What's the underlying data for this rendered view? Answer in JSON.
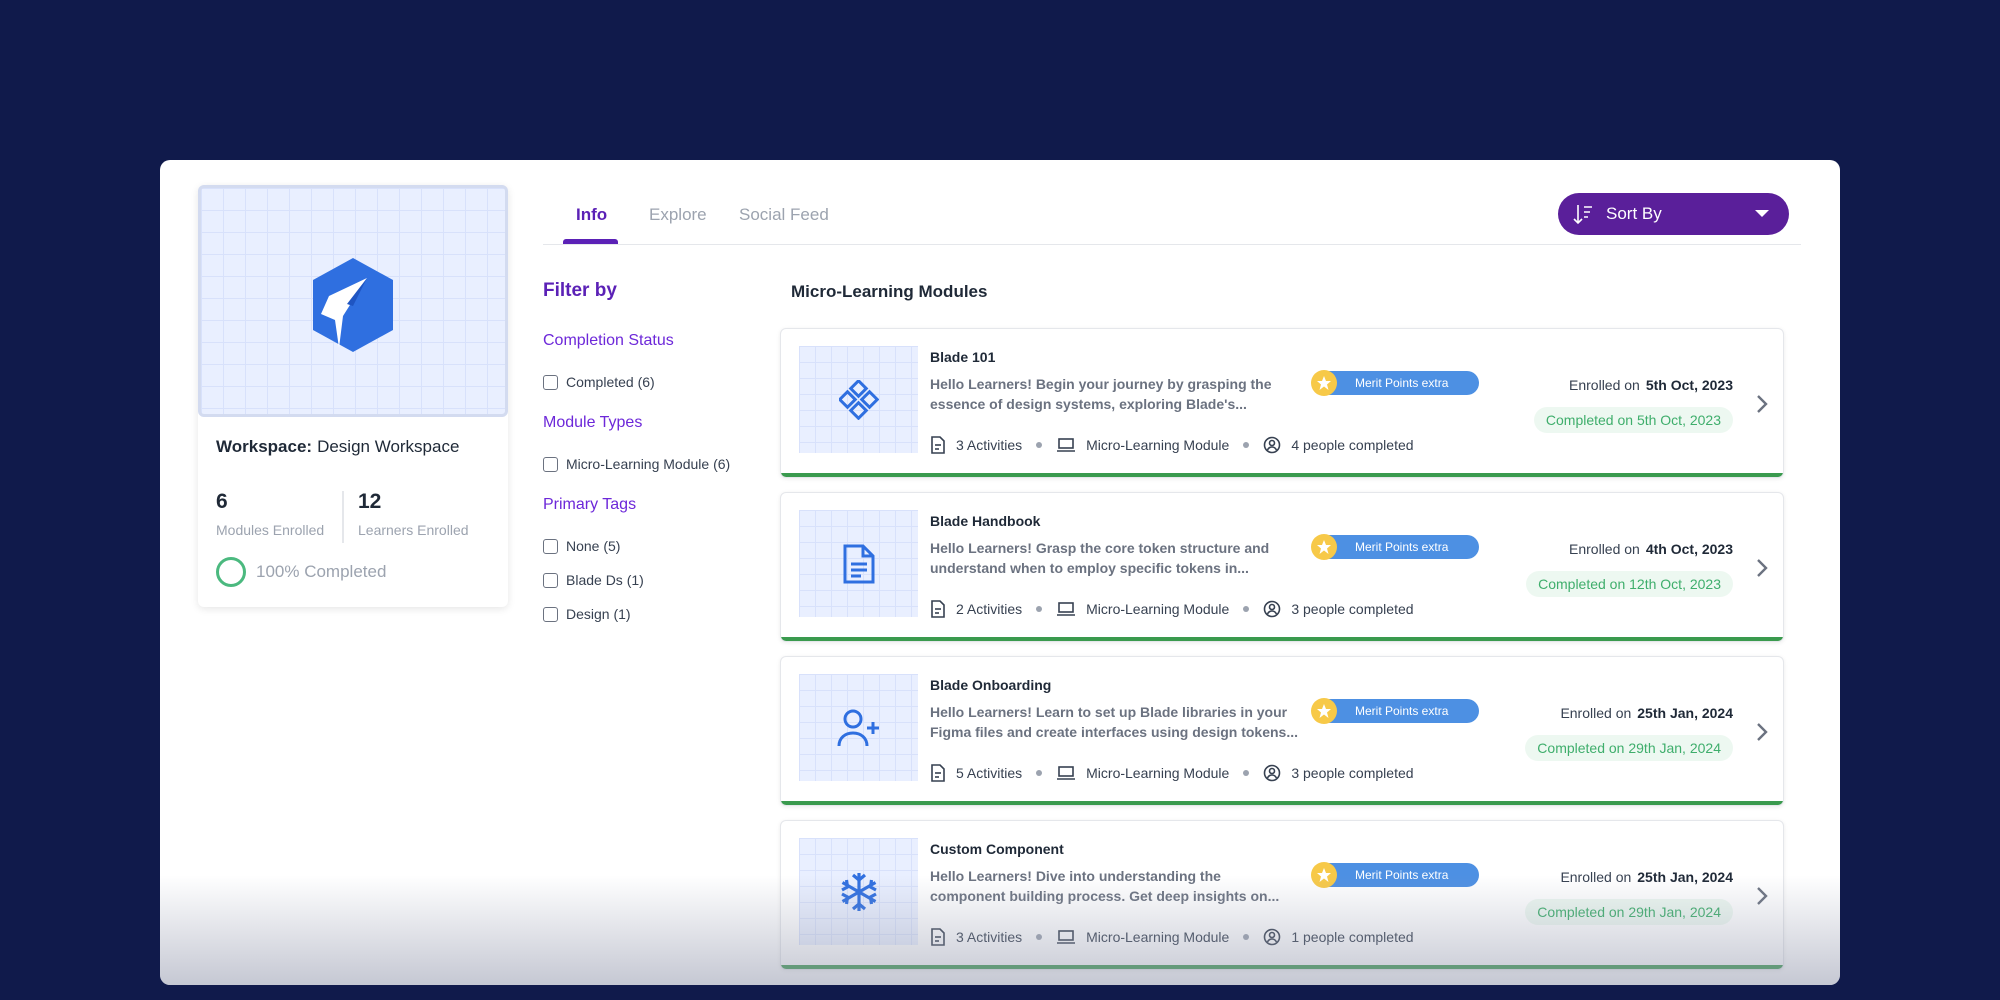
{
  "workspace": {
    "label": "Workspace:",
    "name": "Design Workspace",
    "modules_enrolled": "6",
    "modules_enrolled_label": "Modules Enrolled",
    "learners_enrolled": "12",
    "learners_enrolled_label": "Learners Enrolled",
    "completion_text": "100% Completed",
    "logo_icon": "shield-bolt-logo-icon"
  },
  "tabs": [
    {
      "label": "Info",
      "active": true
    },
    {
      "label": "Explore",
      "active": false
    },
    {
      "label": "Social Feed",
      "active": false
    }
  ],
  "sort": {
    "label": "Sort By",
    "icon": "sort-icon"
  },
  "filter": {
    "title": "Filter by",
    "sections": [
      {
        "title": "Completion Status",
        "options": [
          "Completed (6)"
        ]
      },
      {
        "title": "Module Types",
        "options": [
          "Micro-Learning Module (6)"
        ]
      },
      {
        "title": "Primary Tags",
        "options": [
          "None (5)",
          "Blade Ds (1)",
          "Design (1)"
        ]
      }
    ]
  },
  "modules_heading": "Micro-Learning Modules",
  "modules": [
    {
      "title": "Blade 101",
      "desc1": "Hello Learners! Begin your journey by grasping the",
      "desc2": "essence of design systems, exploring Blade's...",
      "activities": "3 Activities",
      "type": "Micro-Learning Module",
      "people": "4 people completed",
      "merit": "Merit Points extra",
      "enrolled_label": "Enrolled on",
      "enrolled_date": "5th Oct, 2023",
      "completed": "Completed on 5th Oct, 2023",
      "icon": "diamond-grid-icon"
    },
    {
      "title": "Blade Handbook",
      "desc1": "Hello Learners! Grasp the core token structure and",
      "desc2": "understand when to employ specific tokens in...",
      "activities": "2 Activities",
      "type": "Micro-Learning Module",
      "people": "3 people completed",
      "merit": "Merit Points extra",
      "enrolled_label": "Enrolled on",
      "enrolled_date": "4th Oct, 2023",
      "completed": "Completed on 12th Oct, 2023",
      "icon": "document-icon"
    },
    {
      "title": "Blade Onboarding",
      "desc1": "Hello Learners! Learn to set up Blade libraries in your",
      "desc2": "Figma files and create interfaces using design tokens...",
      "activities": "5 Activities",
      "type": "Micro-Learning Module",
      "people": "3 people completed",
      "merit": "Merit Points extra",
      "enrolled_label": "Enrolled on",
      "enrolled_date": "25th Jan, 2024",
      "completed": "Completed on 29th Jan, 2024",
      "icon": "user-plus-icon"
    },
    {
      "title": "Custom Component",
      "desc1": "Hello Learners! Dive into understanding the",
      "desc2": "component building process. Get deep insights on...",
      "activities": "3 Activities",
      "type": "Micro-Learning Module",
      "people": "1 people completed",
      "merit": "Merit Points extra",
      "enrolled_label": "Enrolled on",
      "enrolled_date": "25th Jan, 2024",
      "completed": "Completed on 29th Jan, 2024",
      "icon": "snowflake-icon"
    }
  ],
  "colors": {
    "background": "#101a4b",
    "accent": "#5a1f9a",
    "merit_blue": "#4d90e3",
    "success_green": "#3a9a4e",
    "icon_blue": "#2f6fe0"
  }
}
